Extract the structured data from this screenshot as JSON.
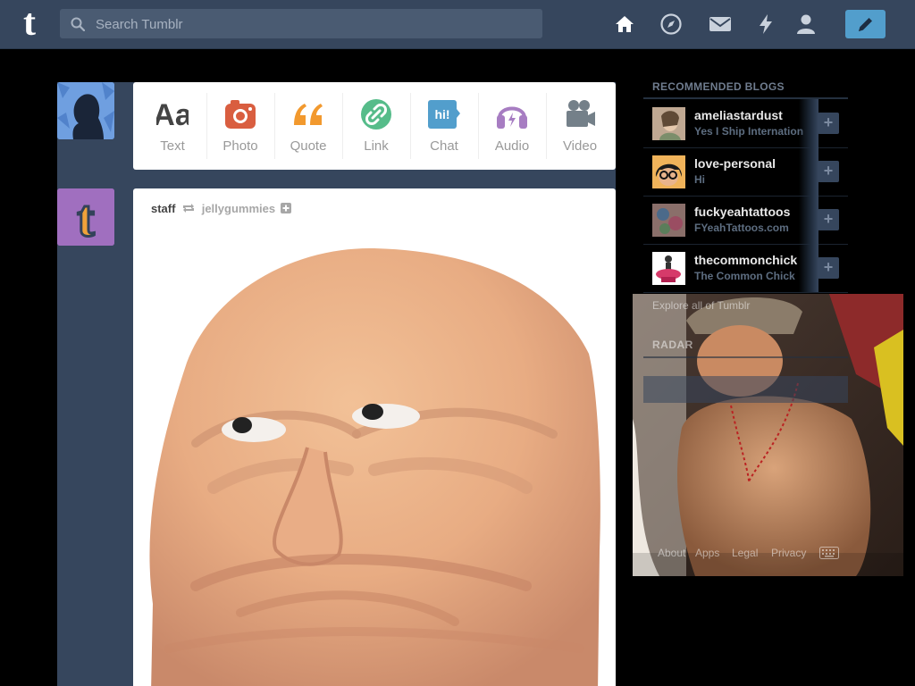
{
  "header": {
    "logo_text": "t",
    "search_placeholder": "Search Tumblr",
    "nav_icons": [
      "home-icon",
      "compass-icon",
      "mail-icon",
      "lightning-icon",
      "account-icon"
    ],
    "compose_icon": "pencil-icon",
    "colors": {
      "header_bg": "#36465d",
      "accent": "#529ecc"
    }
  },
  "post_types": [
    {
      "label": "Text",
      "icon": "text-icon",
      "color": "#444444"
    },
    {
      "label": "Photo",
      "icon": "camera-icon",
      "color": "#d95e40"
    },
    {
      "label": "Quote",
      "icon": "quote-icon",
      "color": "#f2992e"
    },
    {
      "label": "Link",
      "icon": "link-icon",
      "color": "#56bc8a"
    },
    {
      "label": "Chat",
      "icon": "chat-icon",
      "color": "#529ecc"
    },
    {
      "label": "Audio",
      "icon": "headphones-icon",
      "color": "#a77dc2"
    },
    {
      "label": "Video",
      "icon": "video-camera-icon",
      "color": "#748089"
    }
  ],
  "post": {
    "author": "staff",
    "reblog_icon": "reblog-icon",
    "reblogged_from": "jellygummies",
    "follow_icon": "plus-icon"
  },
  "sidebar": {
    "recommended_title": "RECOMMENDED BLOGS",
    "blogs": [
      {
        "name": "ameliastardust",
        "subtitle": "Yes I Ship Internation"
      },
      {
        "name": "love-personal",
        "subtitle": "Hi"
      },
      {
        "name": "fuckyeahtattoos",
        "subtitle": "FYeahTattoos.com"
      },
      {
        "name": "thecommonchick",
        "subtitle": "The Common Chick"
      }
    ],
    "follow_label": "+",
    "explore_link": "Explore all of Tumblr",
    "radar_title": "RADAR",
    "footer_links": [
      "About",
      "Apps",
      "Legal",
      "Privacy"
    ],
    "keyboard_icon": "keyboard-icon"
  }
}
